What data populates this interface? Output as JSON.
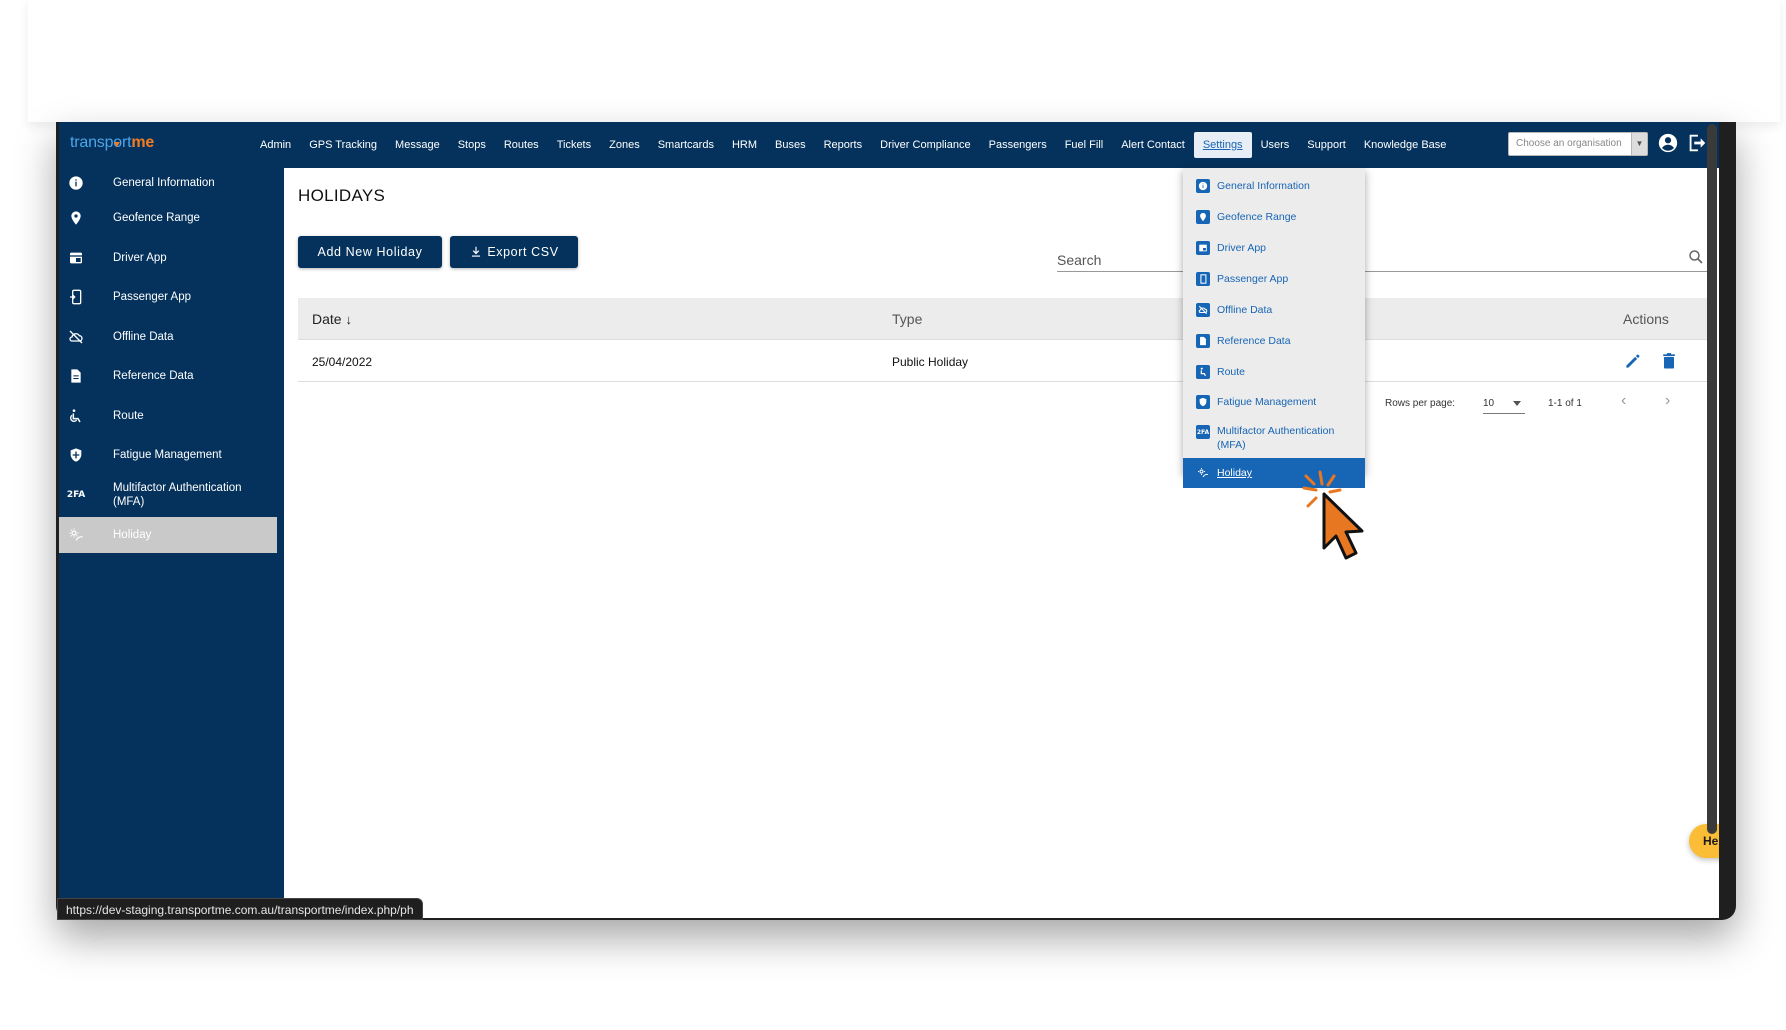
{
  "app": {
    "logo_part1": "transp",
    "logo_part2": "rt",
    "logo_part3": "me"
  },
  "nav": {
    "items": [
      "Admin",
      "GPS Tracking",
      "Message",
      "Stops",
      "Routes",
      "Tickets",
      "Zones",
      "Smartcards",
      "HRM",
      "Buses",
      "Reports",
      "Driver Compliance",
      "Passengers",
      "Fuel Fill",
      "Alert Contact",
      "Settings",
      "Users",
      "Support",
      "Knowledge Base"
    ],
    "active": "Settings",
    "org_placeholder": "Choose an organisation"
  },
  "sidebar": {
    "items": [
      {
        "label": "General Information",
        "icon": "info-icon"
      },
      {
        "label": "Geofence Range",
        "icon": "map-pin-icon"
      },
      {
        "label": "Driver App",
        "icon": "driver-app-icon"
      },
      {
        "label": "Passenger App",
        "icon": "passenger-app-icon"
      },
      {
        "label": "Offline Data",
        "icon": "cloud-off-icon"
      },
      {
        "label": "Reference Data",
        "icon": "document-icon"
      },
      {
        "label": "Route",
        "icon": "accessible-icon"
      },
      {
        "label": "Fatigue Management",
        "icon": "shield-icon"
      },
      {
        "label": "Multifactor Authentication (MFA)",
        "icon": "2fa-icon"
      },
      {
        "label": "Holiday",
        "icon": "holiday-icon"
      }
    ],
    "active": "Holiday"
  },
  "main": {
    "title": "HOLIDAYS",
    "add_button": "Add New Holiday",
    "export_button": "Export CSV",
    "search_placeholder": "Search",
    "table": {
      "headers": {
        "date": "Date",
        "type": "Type",
        "actions": "Actions"
      },
      "rows": [
        {
          "date": "25/04/2022",
          "type": "Public Holiday"
        }
      ]
    },
    "pagination": {
      "rows_per_page_label": "Rows per page:",
      "rows_per_page": "10",
      "range": "1-1 of 1"
    },
    "help": "Help"
  },
  "dropdown": {
    "items": [
      "General Information",
      "Geofence Range",
      "Driver App",
      "Passenger App",
      "Offline Data",
      "Reference Data",
      "Route",
      "Fatigue Management",
      "Multifactor Authentication (MFA)",
      "Holiday"
    ],
    "active": "Holiday"
  },
  "status_bar": {
    "url": "https://dev-staging.transportme.com.au/transportme/index.php/ph"
  },
  "colors": {
    "brand_navy": "#05325c",
    "accent_blue": "#1765b5",
    "logo_blue": "#4aa6ea",
    "logo_orange": "#f47b20",
    "help_yellow": "#fbbc36",
    "cursor_orange": "#e87722"
  }
}
